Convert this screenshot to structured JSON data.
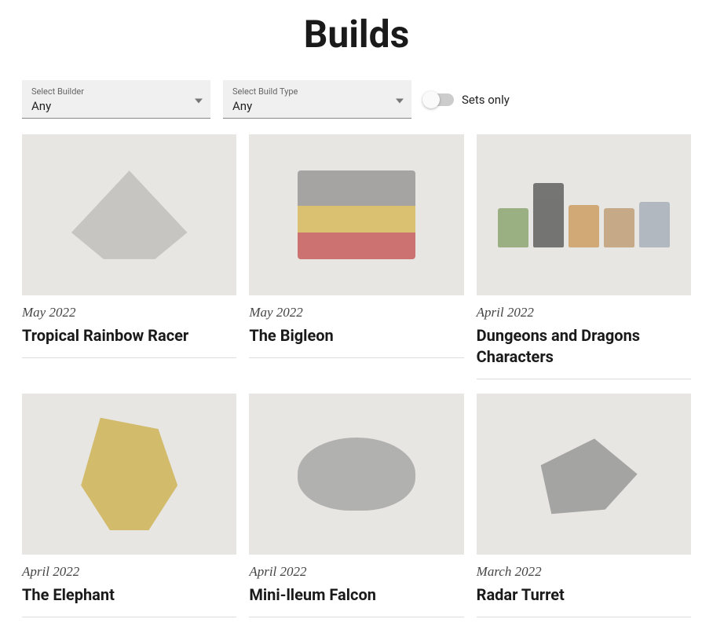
{
  "title": "Builds",
  "filters": {
    "builder": {
      "label": "Select Builder",
      "value": "Any"
    },
    "buildType": {
      "label": "Select Build Type",
      "value": "Any"
    },
    "setsOnly": {
      "label": "Sets only",
      "checked": false
    }
  },
  "builds": [
    {
      "date": "May 2022",
      "title": "Tropical Rainbow Racer"
    },
    {
      "date": "May 2022",
      "title": "The Bigleon"
    },
    {
      "date": "April 2022",
      "title": "Dungeons and Dragons Characters"
    },
    {
      "date": "April 2022",
      "title": "The Elephant"
    },
    {
      "date": "April 2022",
      "title": "Mini-lleum Falcon"
    },
    {
      "date": "March 2022",
      "title": "Radar Turret"
    }
  ]
}
